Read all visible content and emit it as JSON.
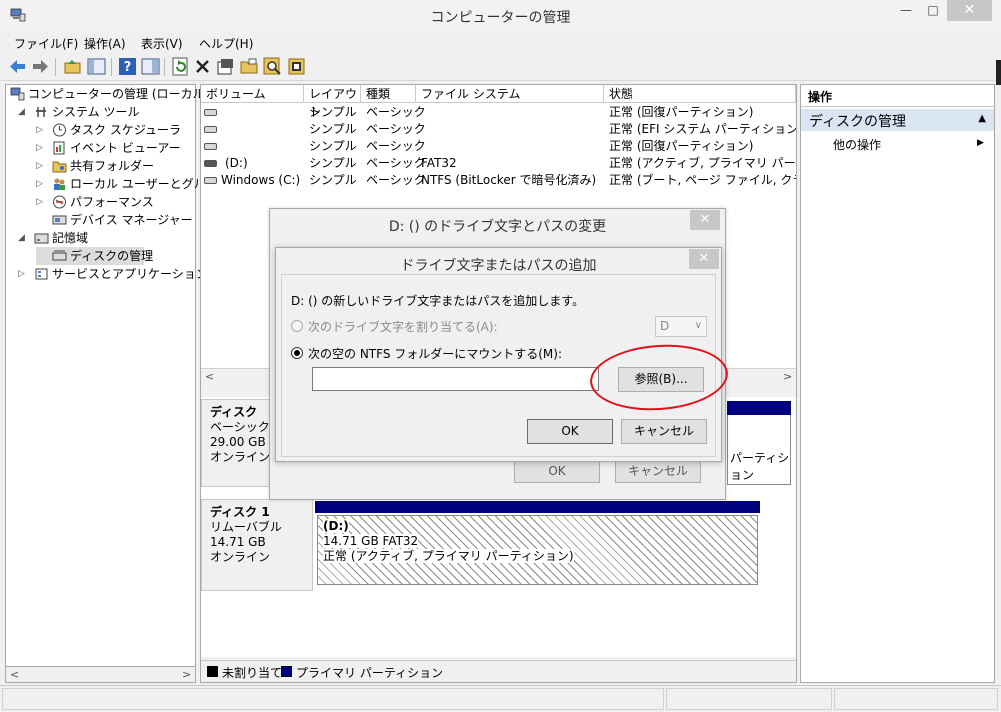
{
  "window": {
    "title": "コンピューターの管理",
    "min": "—",
    "max": "□",
    "close": "✕"
  },
  "menu": [
    "ファイル(F)",
    "操作(A)",
    "表示(V)",
    "ヘルプ(H)"
  ],
  "toolbar_icons": [
    "back-arrow-icon",
    "forward-arrow-icon",
    "up-folder-icon",
    "show-hide-tree-icon",
    "help-icon",
    "properties-pane-icon",
    "refresh-icon",
    "delete-icon",
    "properties-icon",
    "open-folder-icon",
    "search-icon",
    "settings-icon"
  ],
  "tree": {
    "root": "コンピューターの管理 (ローカル)",
    "system_tools": "システム ツール",
    "task_scheduler": "タスク スケジューラ",
    "event_viewer": "イベント ビューアー",
    "shared_folders": "共有フォルダー",
    "local_users": "ローカル ユーザーとグループ",
    "performance": "パフォーマンス",
    "device_manager": "デバイス マネージャー",
    "storage": "記憶域",
    "disk_management": "ディスクの管理",
    "services": "サービスとアプリケーション"
  },
  "volume_list": {
    "headers": [
      "ボリューム",
      "レイアウト",
      "種類",
      "ファイル システム",
      "状態"
    ],
    "rows": [
      {
        "volume": "",
        "layout": "シンプル",
        "type": "ベーシック",
        "fs": "",
        "status": "正常 (回復パーティション)"
      },
      {
        "volume": "",
        "layout": "シンプル",
        "type": "ベーシック",
        "fs": "",
        "status": "正常 (EFI システム パーティション)"
      },
      {
        "volume": "",
        "layout": "シンプル",
        "type": "ベーシック",
        "fs": "",
        "status": "正常 (回復パーティション)"
      },
      {
        "volume": "(D:)",
        "layout": "シンプル",
        "type": "ベーシック",
        "fs": "FAT32",
        "status": "正常 (アクティブ, プライマリ パーティション"
      },
      {
        "volume": "Windows (C:)",
        "layout": "シンプル",
        "type": "ベーシック",
        "fs": "NTFS (BitLocker で暗号化済み)",
        "status": "正常 (ブート, ページ ファイル, クラッシュ"
      }
    ]
  },
  "disk0": {
    "name": "ディスク",
    "type": "ベーシック",
    "size": "29.00 GB",
    "status": "オンライン",
    "partial_text": "パーティション"
  },
  "disk1": {
    "name": "ディスク 1",
    "type": "リムーバブル",
    "size": "14.71 GB",
    "status": "オンライン",
    "partition": {
      "label": "(D:)",
      "size_fs": "14.71 GB FAT32",
      "status": "正常 (アクティブ, プライマリ パーティション)"
    }
  },
  "legend": {
    "unallocated": "未割り当て",
    "primary": "プライマリ パーティション",
    "unallocated_color": "#000000",
    "primary_color": "#00007f"
  },
  "actions": {
    "header": "操作",
    "section": "ディスクの管理",
    "more": "他の操作"
  },
  "dialog_back": {
    "title": "D: () のドライブ文字とパスの変更",
    "close": "✕",
    "ok": "OK",
    "cancel": "キャンセル"
  },
  "dialog_front": {
    "title": "ドライブ文字またはパスの追加",
    "close": "✕",
    "description": "D: () の新しいドライブ文字またはパスを追加します。",
    "assign_letter_label": "次のドライブ文字を割り当てる(A):",
    "assign_letter_value": "D",
    "mount_label": "次の空の NTFS フォルダーにマウントする(M):",
    "mount_path_value": "",
    "browse": "参照(B)...",
    "ok": "OK",
    "cancel": "キャンセル"
  },
  "colors": {
    "accent_bar": "#00007f",
    "selected_section": "#d9e5f3",
    "annotation_circle": "#e3101a"
  }
}
